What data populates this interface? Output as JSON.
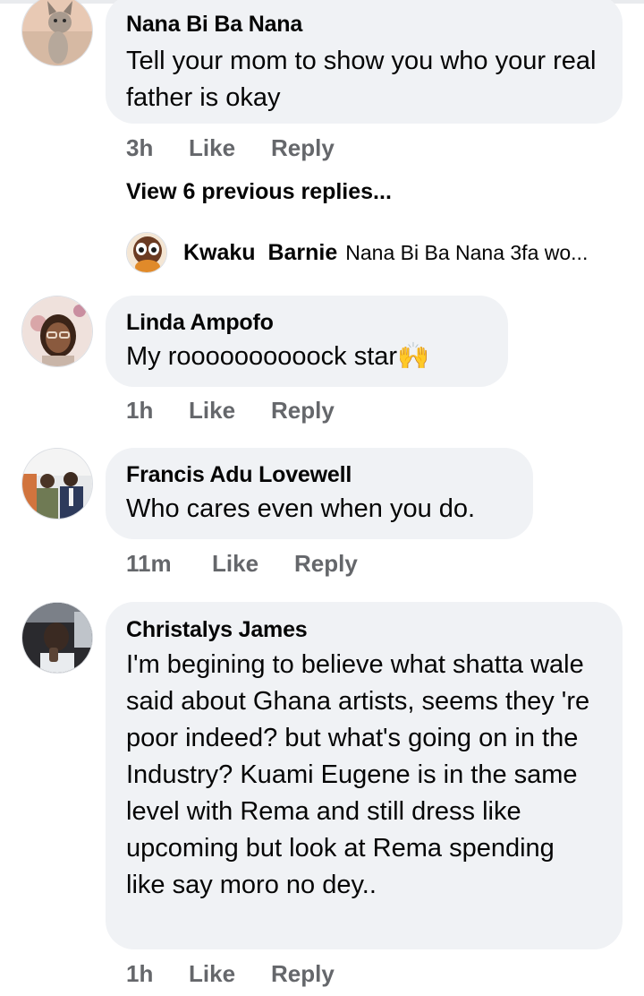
{
  "comments": [
    {
      "name": "Nana Bi Ba Nana",
      "text": "Tell your mom to show you who your real father is okay",
      "time": "3h",
      "like": "Like",
      "reply": "Reply",
      "avatar_icon": "kitten-photo"
    },
    {
      "name": "Linda Ampofo",
      "text": "My roooooooooock star🙌",
      "time": "1h",
      "like": "Like",
      "reply": "Reply",
      "avatar_icon": "woman-photo"
    },
    {
      "name": "Francis Adu Lovewell",
      "text": "Who cares even when you do.",
      "time": "11m",
      "like": "Like",
      "reply": "Reply",
      "avatar_icon": "two-men-photo"
    },
    {
      "name": "Christalys James",
      "text": "I'm begining to believe what shatta wale said about Ghana artists, seems they 're poor indeed? but what's going on in the Industry? Kuami Eugene is in the same level with Rema and still dress like upcoming but look at Rema spending like say moro no dey..",
      "time": "1h",
      "like": "Like",
      "reply": "Reply",
      "avatar_icon": "man-in-car-photo"
    }
  ],
  "replies_thread": {
    "view_previous": "View 6 previous replies...",
    "latest_reply": {
      "author": "Kwaku  Barnie",
      "snippet": "Nana Bi Ba Nana 3fa wo...",
      "avatar_icon": "cartoon-avatar"
    }
  },
  "colors": {
    "bubble": "#f0f2f5",
    "meta_text": "#65676b",
    "text": "#050505"
  }
}
